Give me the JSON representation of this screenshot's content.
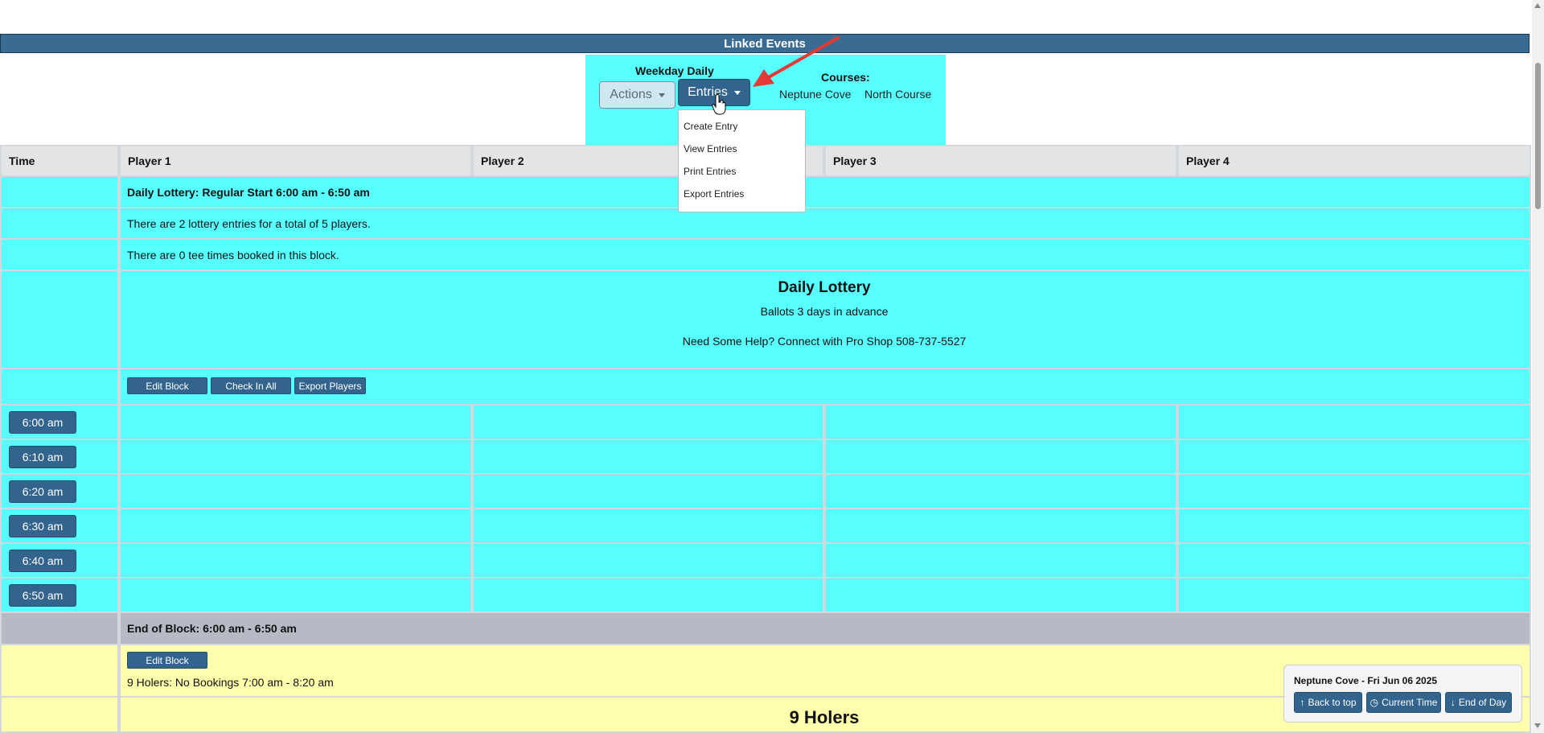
{
  "linked_events_title": "Linked Events",
  "event": {
    "name": "Weekday Daily",
    "actions_label": "Actions",
    "entries_label": "Entries",
    "courses_label": "Courses:",
    "courses": [
      "Neptune Cove",
      "North Course"
    ]
  },
  "entries_menu": [
    "Create Entry",
    "View Entries",
    "Print Entries",
    "Export Entries"
  ],
  "headers": [
    "Time",
    "Player 1",
    "Player 2",
    "Player 3",
    "Player 4"
  ],
  "block": {
    "title": "Daily Lottery: Regular Start 6:00 am - 6:50 am",
    "entries_info": "There are 2 lottery entries for a total of 5 players.",
    "booked_info": "There are 0 tee times booked in this block.",
    "lottery_heading": "Daily Lottery",
    "ballots_text": "Ballots 3 days in advance",
    "help_text": "Need Some Help? Connect with Pro Shop 508-737-5527",
    "buttons": [
      "Edit Block",
      "Check In All",
      "Export Players"
    ],
    "times": [
      "6:00 am",
      "6:10 am",
      "6:20 am",
      "6:30 am",
      "6:40 am",
      "6:50 am"
    ],
    "end_label": "End of Block: 6:00 am - 6:50 am"
  },
  "next_block": {
    "edit_label": "Edit Block",
    "info": "9 Holers: No Bookings 7:00 am - 8:20 am",
    "heading": "9 Holers"
  },
  "nav": {
    "title": "Neptune Cove - Fri Jun 06 2025",
    "back_to_top": "Back to top",
    "current_time": "Current Time",
    "end_of_day": "End of Day"
  },
  "colors": {
    "brand": "#33648e",
    "block_bg": "#57ffff",
    "end_block_bg": "#b6bac4",
    "next_block_bg": "#ffffad",
    "arrow": "#e53935"
  }
}
